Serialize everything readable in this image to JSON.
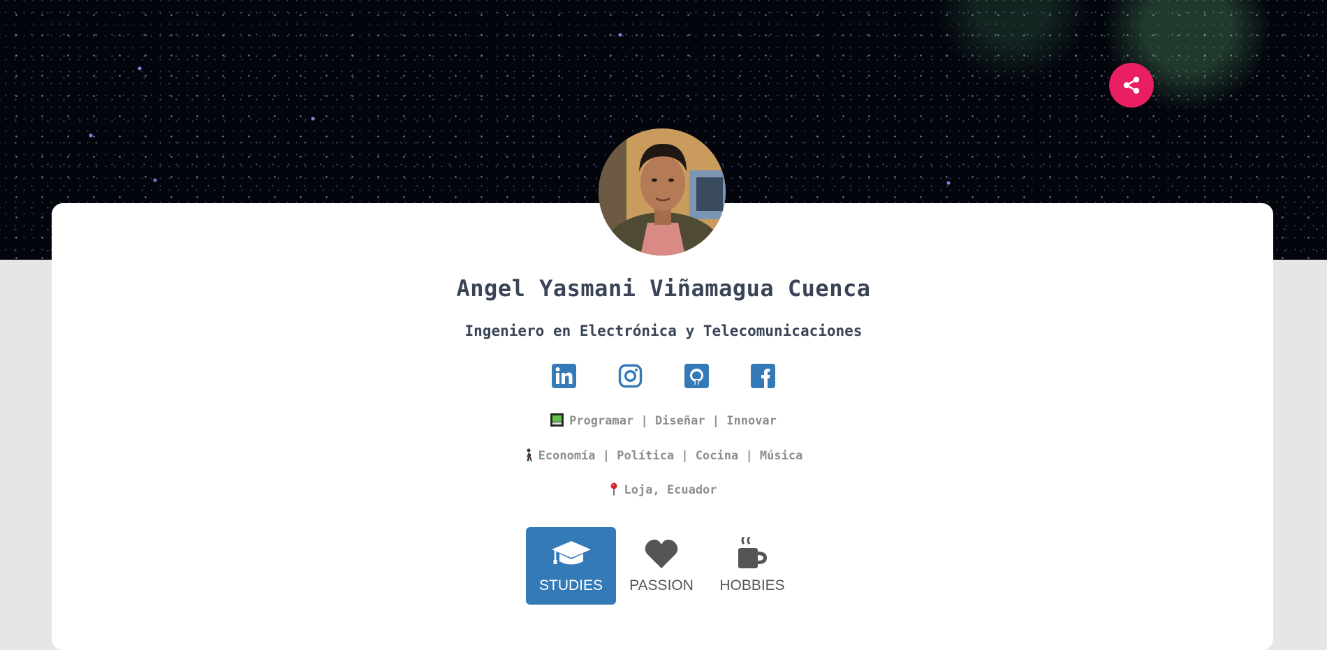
{
  "profile": {
    "name": "Angel Yasmani Viñamagua Cuenca",
    "title": "Ingeniero en Electrónica y Telecomunicaciones"
  },
  "socials": [
    {
      "name": "linkedin",
      "icon": "linkedin-icon"
    },
    {
      "name": "instagram",
      "icon": "instagram-icon"
    },
    {
      "name": "github",
      "icon": "github-icon"
    },
    {
      "name": "facebook",
      "icon": "facebook-icon"
    }
  ],
  "info": {
    "skills": "Programar | Diseñar | Innovar",
    "interests": "Economía | Política | Cocina | Música",
    "location": "Loja, Ecuador"
  },
  "tabs": [
    {
      "label": "STUDIES",
      "icon": "graduation-cap-icon",
      "active": true
    },
    {
      "label": "PASSION",
      "icon": "heart-icon",
      "active": false
    },
    {
      "label": "HOBBIES",
      "icon": "coffee-icon",
      "active": false
    }
  ],
  "colors": {
    "accent": "#337ab7",
    "share": "#e91e63",
    "text": "#3a4456",
    "muted": "#8e8e8e",
    "background": "#e6e6e6"
  }
}
